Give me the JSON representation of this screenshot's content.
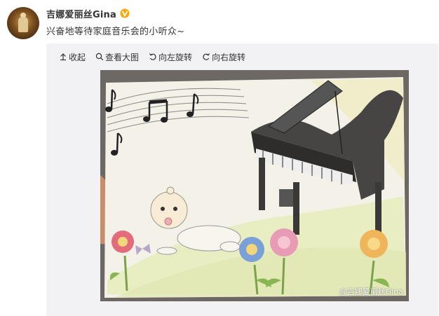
{
  "user": {
    "name": "吉娜爱丽丝Gina",
    "verified_icon": "verified-badge-icon",
    "verified_color": "#f7a80b"
  },
  "post": {
    "text": "兴奋地等待家庭音乐会的小听众~"
  },
  "toolbar": {
    "collapse_label": "收起",
    "collapse_icon": "arrow-up-icon",
    "view_large_label": "查看大图",
    "view_large_icon": "magnifier-icon",
    "rotate_left_label": "向左旋转",
    "rotate_left_icon": "rotate-left-icon",
    "rotate_right_label": "向右旋转",
    "rotate_right_icon": "rotate-right-icon"
  },
  "image": {
    "description_icon": "child-drawing-piano-baby-flowers",
    "watermark": "@吉娜爱丽丝Gina"
  },
  "colors": {
    "text": "#333333",
    "media_bg": "#f2f2f5",
    "badge": "#f7a80b"
  }
}
